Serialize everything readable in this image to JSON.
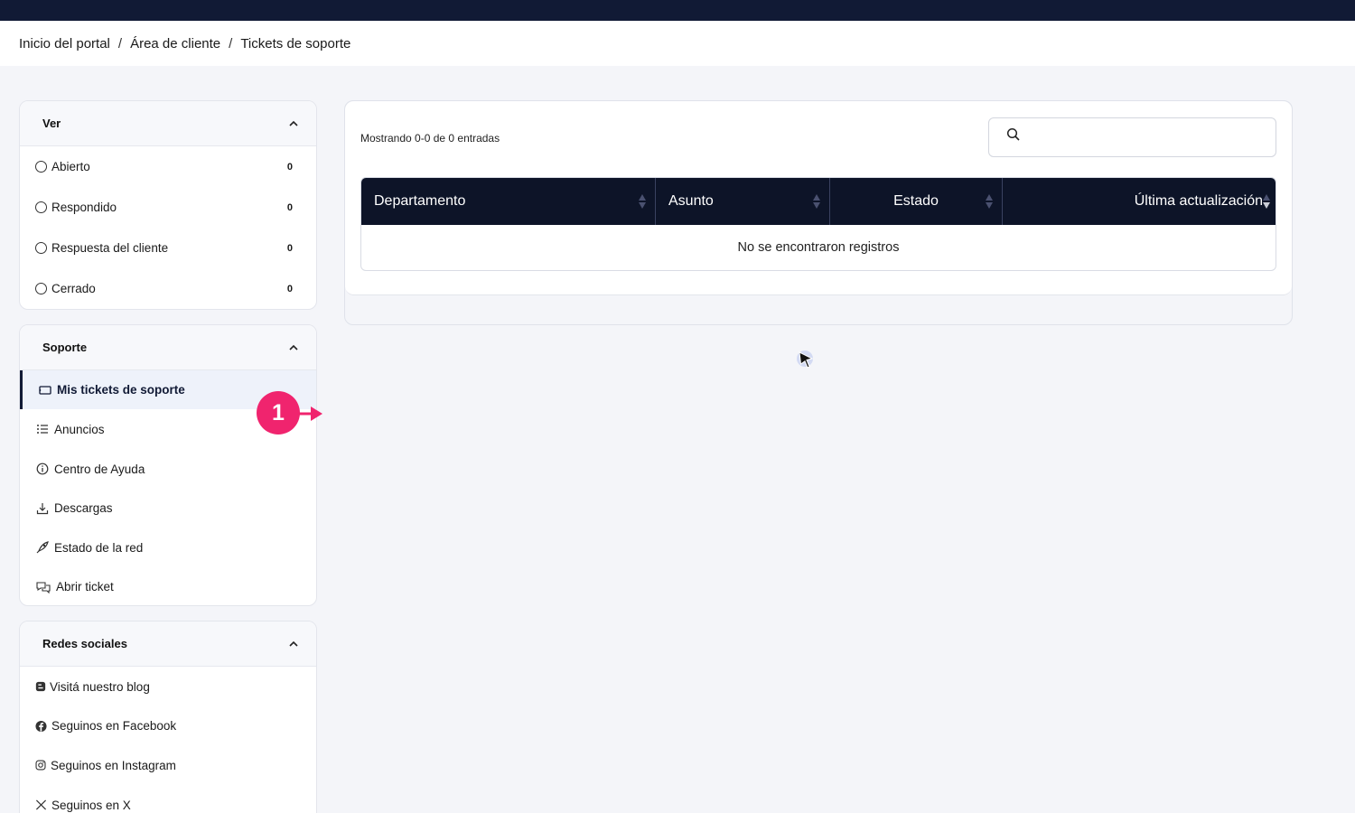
{
  "breadcrumb": {
    "items": [
      "Inicio del portal",
      "Área de cliente",
      "Tickets de soporte"
    ],
    "separator": "/"
  },
  "view_panel": {
    "title": "Ver",
    "items": [
      {
        "label": "Abierto",
        "count": "0"
      },
      {
        "label": "Respondido",
        "count": "0"
      },
      {
        "label": "Respuesta del cliente",
        "count": "0"
      },
      {
        "label": "Cerrado",
        "count": "0"
      }
    ]
  },
  "support_panel": {
    "title": "Soporte",
    "items": [
      {
        "label": "Mis tickets de soporte",
        "icon": "ticket-icon",
        "active": true
      },
      {
        "label": "Anuncios",
        "icon": "list-icon"
      },
      {
        "label": "Centro de Ayuda",
        "icon": "info-icon"
      },
      {
        "label": "Descargas",
        "icon": "download-icon"
      },
      {
        "label": "Estado de la red",
        "icon": "rocket-icon"
      },
      {
        "label": "Abrir ticket",
        "icon": "chat-icon"
      }
    ]
  },
  "social_panel": {
    "title": "Redes sociales",
    "items": [
      {
        "label": "Visitá nuestro blog",
        "icon": "blogger-icon"
      },
      {
        "label": "Seguinos en Facebook",
        "icon": "facebook-icon"
      },
      {
        "label": "Seguinos en Instagram",
        "icon": "instagram-icon"
      },
      {
        "label": "Seguinos en X",
        "icon": "x-icon"
      }
    ]
  },
  "tickets": {
    "showing_text": "Mostrando 0-0 de 0 entradas",
    "search_placeholder": "",
    "columns": [
      "Departamento",
      "Asunto",
      "Estado",
      "Última actualización"
    ],
    "empty_text": "No se encontraron registros"
  },
  "annotation": {
    "step_number": "1",
    "color": "#f0246e"
  },
  "colors": {
    "navy": "#111a35",
    "table_header": "#0d1428",
    "accent_pink": "#f0246e"
  }
}
